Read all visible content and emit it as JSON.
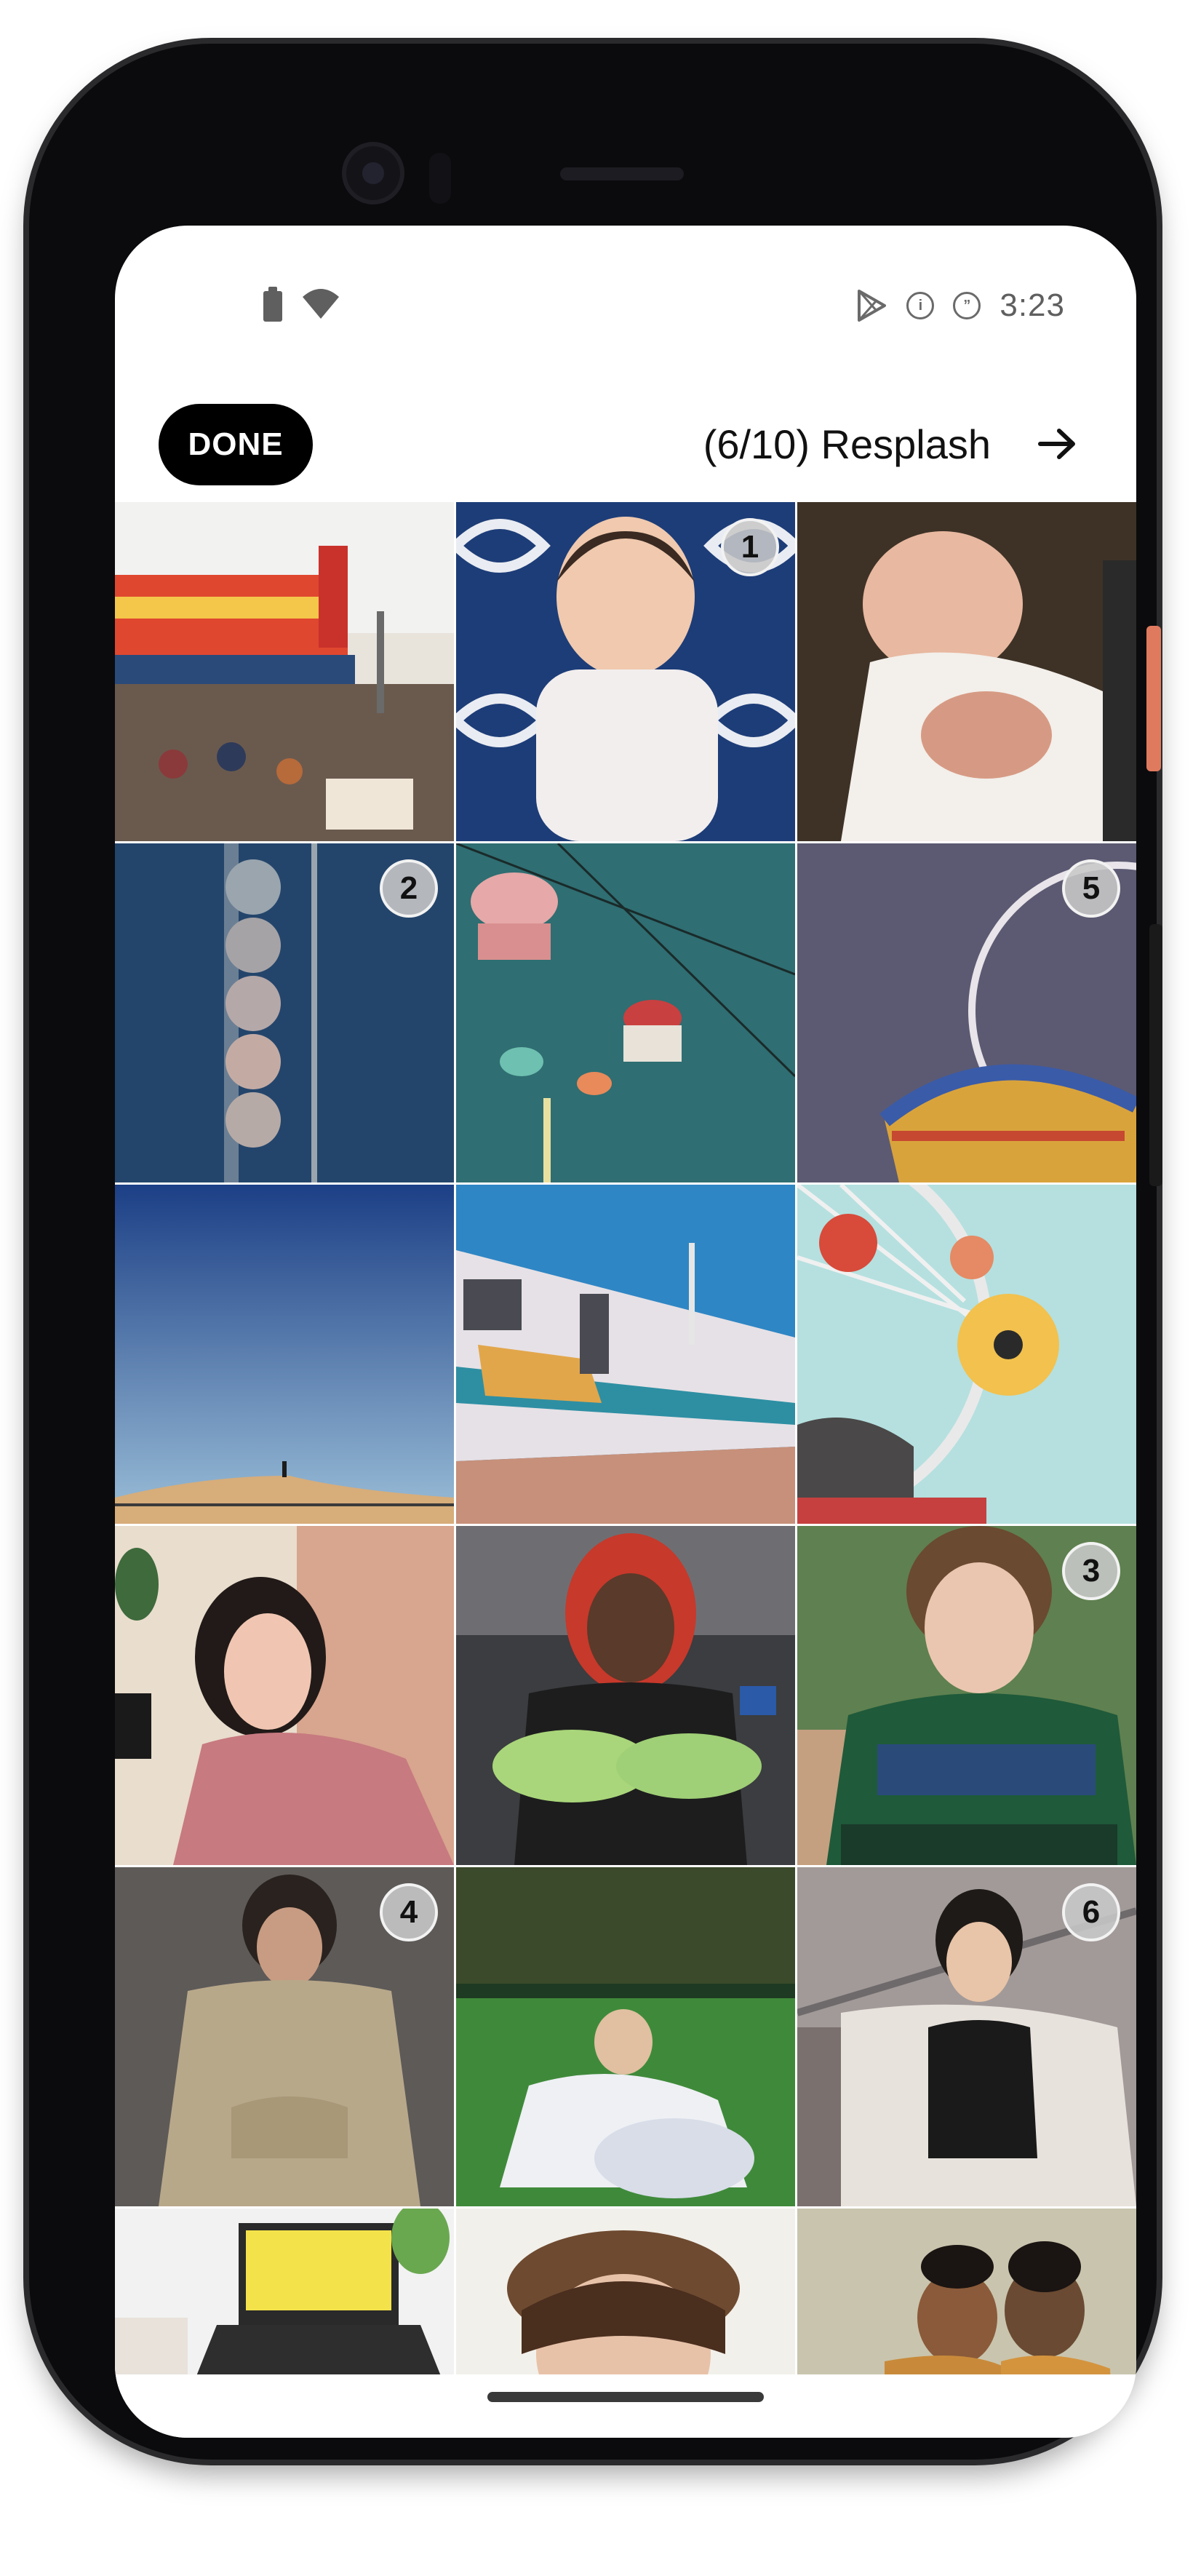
{
  "status_bar": {
    "time": "3:23",
    "icons": [
      "battery-icon",
      "wifi-icon",
      "play-store-icon",
      "info-icon",
      "quote-icon"
    ],
    "info_glyph": "i",
    "quote_glyph": "”"
  },
  "toolbar": {
    "done_label": "DONE",
    "title": "(6/10) Resplash",
    "next_icon": "arrow-right-icon"
  },
  "grid": {
    "columns": 3,
    "photos": [
      {
        "id": "hot-dog-stand",
        "selected": null
      },
      {
        "id": "baby-portrait",
        "selected": "1"
      },
      {
        "id": "newborn",
        "selected": null
      },
      {
        "id": "motel-sign",
        "selected": "2"
      },
      {
        "id": "cable-cars",
        "selected": null
      },
      {
        "id": "ferris-wheel-swing",
        "selected": "5"
      },
      {
        "id": "desert-dune",
        "selected": null
      },
      {
        "id": "train",
        "selected": null
      },
      {
        "id": "ferris-wheel-yellow",
        "selected": null
      },
      {
        "id": "woman-phone",
        "selected": null
      },
      {
        "id": "woman-green-gloves",
        "selected": null
      },
      {
        "id": "man-glasses",
        "selected": "3"
      },
      {
        "id": "woman-khaki",
        "selected": "4"
      },
      {
        "id": "couple-grass",
        "selected": null
      },
      {
        "id": "man-stairs",
        "selected": "6"
      },
      {
        "id": "laptop",
        "selected": null
      },
      {
        "id": "woman-cap",
        "selected": null
      },
      {
        "id": "couple-smiling",
        "selected": null
      }
    ]
  },
  "colors": {
    "done_bg": "#000000",
    "done_text": "#ffffff",
    "badge_bg": "#c8c8c8",
    "device_frame": "#0b0b0d"
  }
}
